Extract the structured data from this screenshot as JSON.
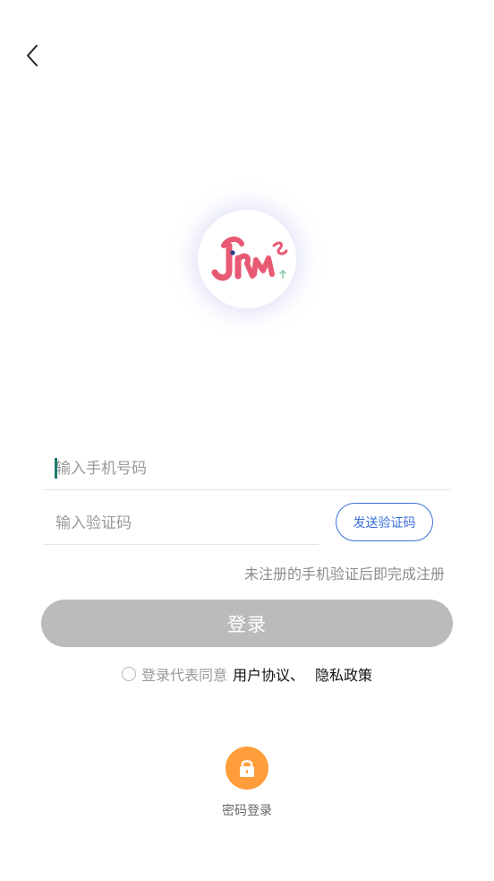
{
  "header": {
    "back_icon": "chevron-left-icon"
  },
  "logo": {
    "text": "JRM",
    "colors": {
      "primary": "#e85a73",
      "eye": "#2d3b8a",
      "accent": "#7fc7a0"
    }
  },
  "form": {
    "phone_placeholder": "输入手机号码",
    "phone_value": "",
    "code_placeholder": "输入验证码",
    "code_value": "",
    "send_code_label": "发送验证码",
    "hint": "未注册的手机验证后即完成注册",
    "login_label": "登录"
  },
  "agreement": {
    "checked": false,
    "prefix": "登录代表同意",
    "user_agreement": "用户协议、",
    "privacy_policy": "隐私政策"
  },
  "password_login": {
    "icon": "lock-icon",
    "label": "密码登录"
  },
  "colors": {
    "accent_blue": "#3b6fd9",
    "login_disabled": "#bbbbbb",
    "lock_orange": "#ff9d3a",
    "caret": "#1f7a6b"
  }
}
